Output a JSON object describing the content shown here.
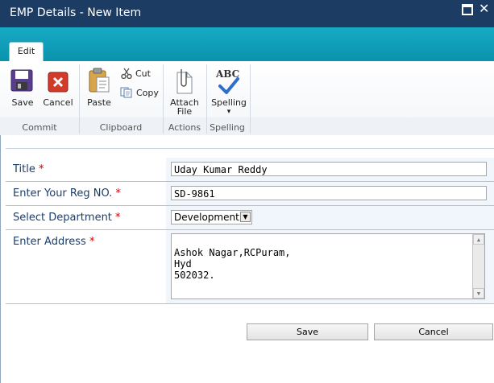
{
  "window": {
    "title": "EMP Details - New Item",
    "maximize_icon": "maximize-icon",
    "close_icon": "close-icon",
    "close_glyph": "✕"
  },
  "ribbon": {
    "tab": "Edit",
    "groups": {
      "commit": "Commit",
      "clipboard": "Clipboard",
      "actions": "Actions",
      "spelling": "Spelling"
    },
    "buttons": {
      "save": "Save",
      "cancel": "Cancel",
      "paste": "Paste",
      "cut": "Cut",
      "copy": "Copy",
      "attach_line1": "Attach",
      "attach_line2": "File",
      "spelling": "Spelling",
      "spelling_arrow": "▾",
      "abc": "ABC"
    }
  },
  "form": {
    "fields": [
      {
        "label": "Title",
        "required": "*",
        "value": "Uday Kumar Reddy"
      },
      {
        "label": "Enter Your Reg NO.",
        "required": "*",
        "value": "SD-9861"
      },
      {
        "label": "Select Department",
        "required": "*",
        "value": "Development",
        "arrow": "▼"
      },
      {
        "label": "Enter Address",
        "required": "*",
        "value": "Ashok Nagar,RCPuram,\nHyd\n502032."
      }
    ],
    "save_label": "Save",
    "cancel_label": "Cancel"
  },
  "colors": {
    "titlebar": "#1c3c63",
    "ribbon_strip": "#0c9db8",
    "label_text": "#1a3e6e",
    "required": "#cc0000"
  }
}
